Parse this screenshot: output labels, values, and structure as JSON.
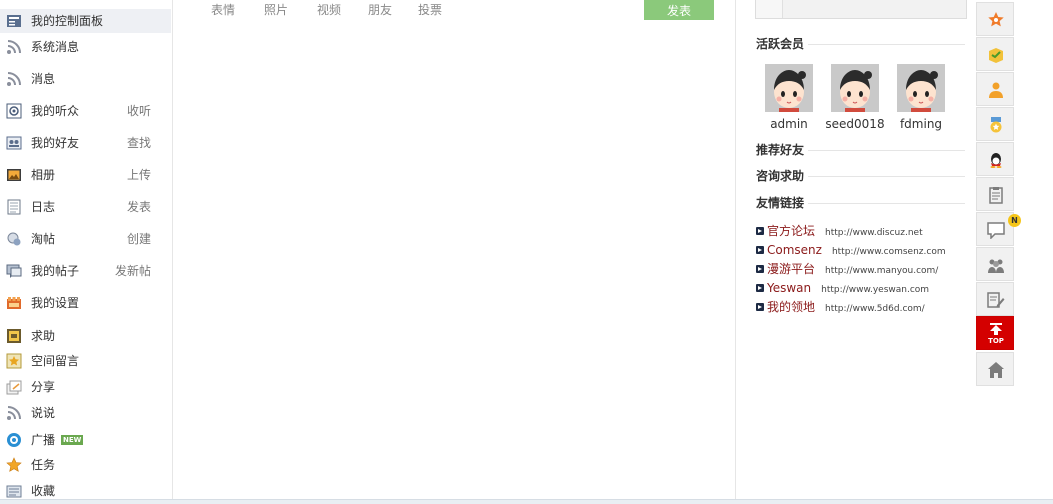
{
  "sidebar": {
    "items": [
      {
        "label": "我的控制面板",
        "action": "",
        "icon": "control-panel-icon"
      },
      {
        "label": "系统消息",
        "action": "",
        "icon": "rss-icon"
      },
      {
        "label": "消息",
        "action": "",
        "icon": "rss-icon"
      },
      {
        "label": "我的听众",
        "action": "收听",
        "icon": "listeners-icon"
      },
      {
        "label": "我的好友",
        "action": "查找",
        "icon": "friends-icon"
      },
      {
        "label": "相册",
        "action": "上传",
        "icon": "album-icon"
      },
      {
        "label": "日志",
        "action": "发表",
        "icon": "blog-icon"
      },
      {
        "label": "淘帖",
        "action": "创建",
        "icon": "collection-icon"
      },
      {
        "label": "我的帖子",
        "action": "发新帖",
        "icon": "posts-icon"
      },
      {
        "label": "我的设置",
        "action": "",
        "icon": "settings-icon"
      },
      {
        "label": "求助",
        "action": "",
        "icon": "help-icon"
      },
      {
        "label": "空间留言",
        "action": "",
        "icon": "guestbook-icon"
      },
      {
        "label": "分享",
        "action": "",
        "icon": "share-icon"
      },
      {
        "label": "说说",
        "action": "",
        "icon": "rss-icon"
      },
      {
        "label": "广播",
        "action": "",
        "icon": "broadcast-icon",
        "badge": "NEW"
      },
      {
        "label": "任务",
        "action": "",
        "icon": "task-star-icon"
      },
      {
        "label": "收藏",
        "action": "",
        "icon": "favorites-icon"
      }
    ]
  },
  "composer": {
    "tabs": [
      "表情",
      "照片",
      "视频",
      "朋友",
      "投票"
    ],
    "post_label": "发表"
  },
  "right": {
    "active_members_title": "活跃会员",
    "members": [
      {
        "name": "admin"
      },
      {
        "name": "seed0018"
      },
      {
        "name": "fdming"
      }
    ],
    "recommend_title": "推荐好友",
    "consult_title": "咨询求助",
    "links_title": "友情链接",
    "links": [
      {
        "name": "官方论坛",
        "url": "http://www.discuz.net"
      },
      {
        "name": "Comsenz",
        "url": "http://www.comsenz.com"
      },
      {
        "name": "漫游平台",
        "url": "http://www.manyou.com/"
      },
      {
        "name": "Yeswan",
        "url": "http://www.yeswan.com"
      },
      {
        "name": "我的领地",
        "url": "http://www.5d6d.com/"
      }
    ]
  },
  "toolbar": {
    "notice_badge": "N",
    "top_label": "TOP",
    "buttons": [
      "star-badge-icon",
      "folder-icon",
      "user-icon",
      "medal-icon",
      "qq-icon",
      "clipboard-icon",
      "comment-icon",
      "group-icon",
      "edit-icon",
      "top-icon",
      "home-icon"
    ]
  },
  "colors": {
    "post_button": "#8bc97b",
    "top_button": "#d40000",
    "link_name": "#8b1a1a"
  }
}
